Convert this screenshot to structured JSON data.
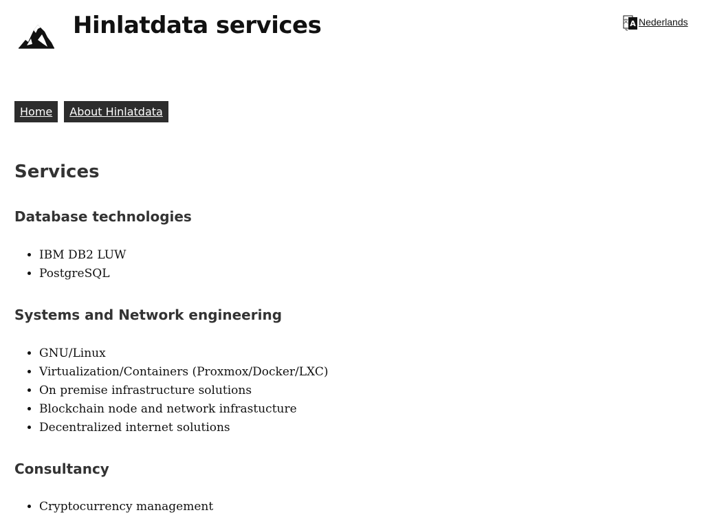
{
  "header": {
    "title": "Hinlatdata services",
    "logo_icon": "mountain-logo-icon",
    "language_icon": "translate-icon",
    "language_link": "Nederlands"
  },
  "nav": {
    "items": [
      {
        "label": "Home",
        "current": true
      },
      {
        "label": "About Hinlatdata",
        "current": false
      }
    ]
  },
  "main": {
    "heading": "Services",
    "sections": [
      {
        "title": "Database technologies",
        "items": [
          "IBM DB2 LUW",
          "PostgreSQL"
        ]
      },
      {
        "title": "Systems and Network engineering",
        "items": [
          "GNU/Linux",
          "Virtualization/Containers (Proxmox/Docker/LXC)",
          "On premise infrastructure solutions",
          "Blockchain node and network infrastucture",
          "Decentralized internet solutions"
        ]
      },
      {
        "title": "Consultancy",
        "items": [
          "Cryptocurrency management"
        ]
      }
    ]
  },
  "colors": {
    "nav_background": "#2d2d2d",
    "heading_text": "#333333",
    "body_text": "#111111"
  }
}
